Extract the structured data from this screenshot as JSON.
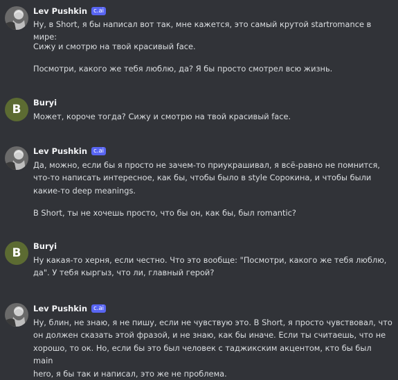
{
  "chat": {
    "messages": [
      {
        "author": "Lev Pushkin",
        "badge": "c.ai",
        "paragraphs": [
          "Ну, в Short, я бы написал вот так, мне кажется, это самый крутой startromance в мире:",
          "Сижу и смотрю на твой красивый face.",
          "Посмотри, какого же тебя люблю, да? Я бы просто смотрел всю жизнь."
        ]
      },
      {
        "author": "Buryi",
        "avatar_letter": "B",
        "paragraphs": [
          "Может, короче тогда? Сижу и смотрю на твой красивый face."
        ]
      },
      {
        "author": "Lev Pushkin",
        "badge": "c.ai",
        "paragraphs": [
          "Да, можно, если бы я просто не зачем-то приукрашивал, я всё-равно не помнится,\nчто-то написать интересное, как бы, чтобы было в style Сорокина, и чтобы были\nкакие-то deep meanings.",
          "В Short, ты не хочешь просто, что бы он, как бы, был romantic?"
        ]
      },
      {
        "author": "Buryi",
        "avatar_letter": "B",
        "paragraphs": [
          "Ну какая-то херня, если честно. Что это вообще: \"Посмотри, какого же тебя люблю,\nда\". У тебя кыргыз, что ли, главный герой?"
        ]
      },
      {
        "author": "Lev Pushkin",
        "badge": "c.ai",
        "paragraphs": [
          "Ну, блин, не знаю, я не пишу, если не чувствую это. В Short, я просто чувствовал, что\nон должен сказать этой фразой, и не знаю, как бы иначе. Если ты считаешь, что не\nхорошо, то ок. Но, если бы это был человек с таджикским акцентом, кто бы был main\nhero, я бы так и написал, это же не проблема."
        ]
      }
    ]
  },
  "colors": {
    "background": "#313338",
    "text": "#dbdee1",
    "author": "#f2f3f5",
    "badge": "#5865f2",
    "buryi_avatar": "#5c6b32"
  },
  "icons": {
    "lev_avatar": "portrait-avatar-icon"
  }
}
